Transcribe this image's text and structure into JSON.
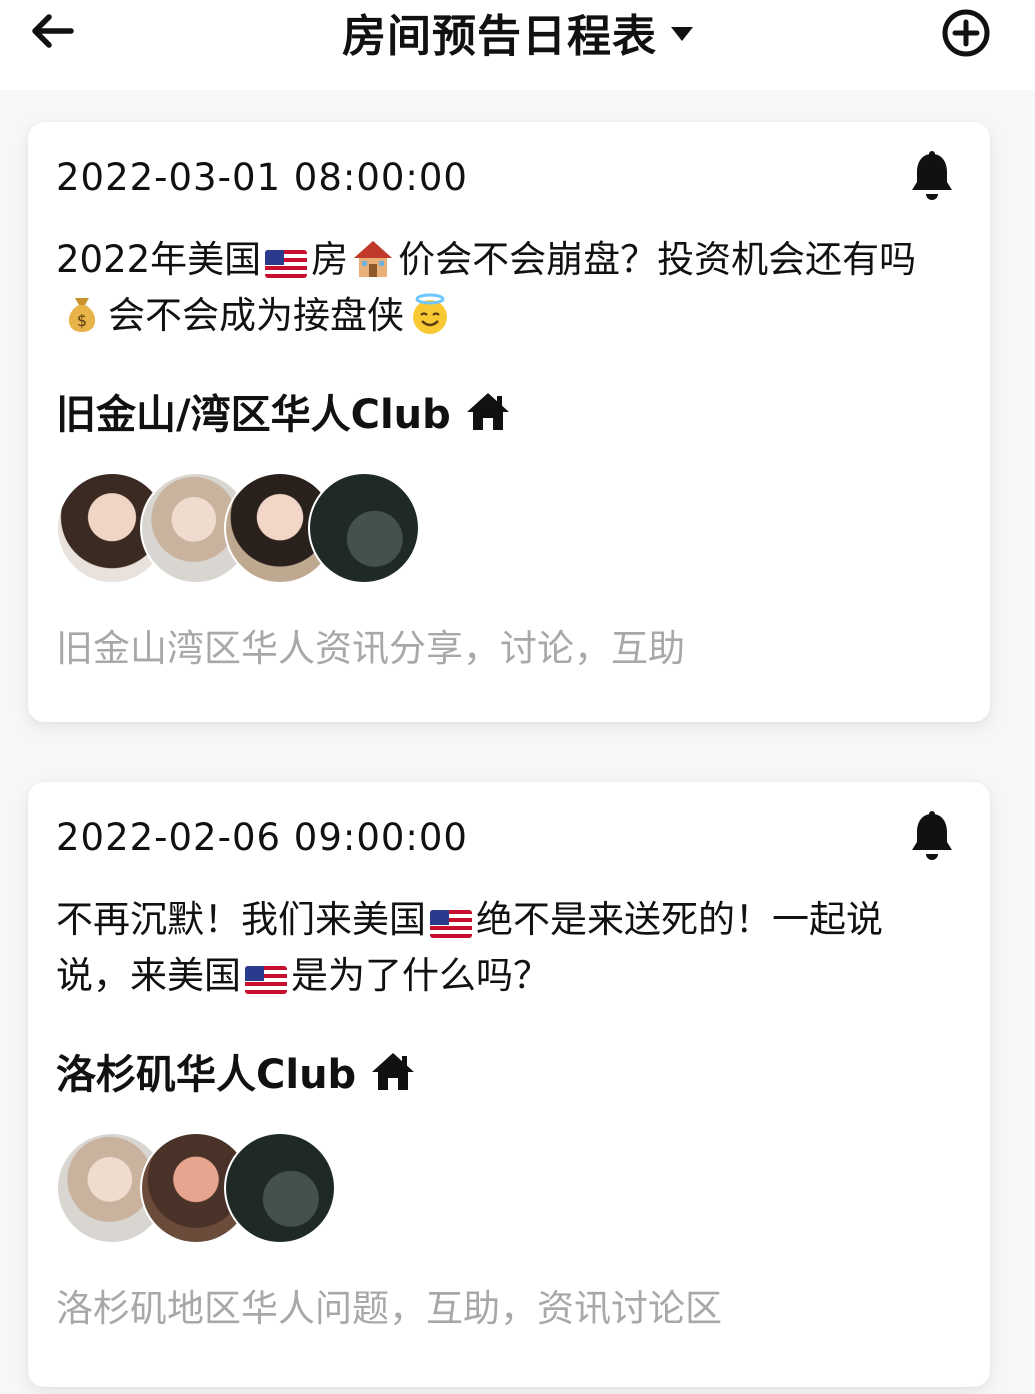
{
  "header": {
    "title": "房间预告日程表"
  },
  "events": [
    {
      "time": "2022-03-01 08:00:00",
      "text_parts": [
        "2022年美国",
        "房",
        "价会不会崩盘？投资机会还有吗",
        "会不会成为接盘侠"
      ],
      "club": "旧金山/湾区华人Club",
      "subtitle": "旧金山湾区华人资讯分享，讨论，互助",
      "avatar_count": 4
    },
    {
      "time": "2022-02-06 09:00:00",
      "text_parts": [
        "不再沉默！我们来美国",
        "绝不是来送死的！一起说说，来美国",
        "是为了什么吗？"
      ],
      "club": "洛杉矶华人Club",
      "subtitle": "洛杉矶地区华人问题，互助，资讯讨论区",
      "avatar_count": 3
    }
  ],
  "icons": {
    "back": "arrow-left-icon",
    "add": "plus-circle-icon",
    "bell": "bell-icon",
    "house": "house-icon",
    "us_flag": "us-flag-emoji",
    "house_emoji": "house-emoji",
    "money_bag": "money-bag-emoji",
    "halo_face": "smiling-face-with-halo-emoji"
  },
  "colors": {
    "text": "#111111",
    "muted": "#a8a8a8",
    "card": "#ffffff",
    "background": "#f7f7f7"
  }
}
